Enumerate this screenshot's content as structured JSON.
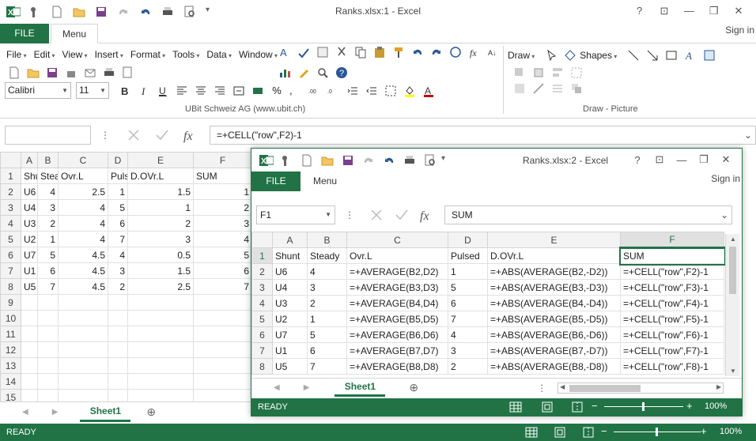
{
  "main": {
    "title": "Ranks.xlsx:1 - Excel",
    "tabs": {
      "file": "FILE",
      "menu": "Menu"
    },
    "signin": "Sign in",
    "menubar": [
      "File",
      "Edit",
      "View",
      "Insert",
      "Format",
      "Tools",
      "Data",
      "Window"
    ],
    "draw_items": [
      "Draw",
      "Shapes"
    ],
    "font_name": "Calibri",
    "font_size": "11",
    "group_labels": {
      "ubit": "UBit Schweiz AG   (www.ubit.ch)",
      "draw": "Draw - Picture"
    },
    "namebox": "",
    "formula": "=+CELL(\"row\",F2)-1",
    "columns": [
      "",
      "A",
      "B",
      "C",
      "D",
      "E",
      "F"
    ],
    "rows": [
      [
        "1",
        "Shunt",
        "Steady",
        "Ovr.L",
        "Pulsed",
        "D.OVr.L",
        "SUM"
      ],
      [
        "2",
        "U6",
        "4",
        "2.5",
        "1",
        "1.5",
        "1"
      ],
      [
        "3",
        "U4",
        "3",
        "4",
        "5",
        "1",
        "2"
      ],
      [
        "4",
        "U3",
        "2",
        "4",
        "6",
        "2",
        "3"
      ],
      [
        "5",
        "U2",
        "1",
        "4",
        "7",
        "3",
        "4"
      ],
      [
        "6",
        "U7",
        "5",
        "4.5",
        "4",
        "0.5",
        "5"
      ],
      [
        "7",
        "U1",
        "6",
        "4.5",
        "3",
        "1.5",
        "6"
      ],
      [
        "8",
        "U5",
        "7",
        "4.5",
        "2",
        "2.5",
        "7"
      ],
      [
        "9",
        "",
        "",
        "",
        "",
        "",
        ""
      ],
      [
        "10",
        "",
        "",
        "",
        "",
        "",
        ""
      ],
      [
        "11",
        "",
        "",
        "",
        "",
        "",
        ""
      ],
      [
        "12",
        "",
        "",
        "",
        "",
        "",
        ""
      ],
      [
        "13",
        "",
        "",
        "",
        "",
        "",
        ""
      ],
      [
        "14",
        "",
        "",
        "",
        "",
        "",
        ""
      ],
      [
        "15",
        "",
        "",
        "",
        "",
        "",
        ""
      ]
    ],
    "sheet_tab": "Sheet1",
    "status_left": "READY",
    "zoom": "100%"
  },
  "win2": {
    "title": "Ranks.xlsx:2 - Excel",
    "tabs": {
      "file": "FILE",
      "menu": "Menu"
    },
    "signin": "Sign in",
    "namebox": "F1",
    "formula": "SUM",
    "columns": [
      "",
      "A",
      "B",
      "C",
      "D",
      "E",
      "F"
    ],
    "rows": [
      [
        "1",
        "Shunt",
        "Steady",
        "Ovr.L",
        "Pulsed",
        "D.OVr.L",
        "SUM"
      ],
      [
        "2",
        "U6",
        "4",
        "=+AVERAGE(B2,D2)",
        "1",
        "=+ABS(AVERAGE(B2,-D2))",
        "=+CELL(\"row\",F2)-1"
      ],
      [
        "3",
        "U4",
        "3",
        "=+AVERAGE(B3,D3)",
        "5",
        "=+ABS(AVERAGE(B3,-D3))",
        "=+CELL(\"row\",F3)-1"
      ],
      [
        "4",
        "U3",
        "2",
        "=+AVERAGE(B4,D4)",
        "6",
        "=+ABS(AVERAGE(B4,-D4))",
        "=+CELL(\"row\",F4)-1"
      ],
      [
        "5",
        "U2",
        "1",
        "=+AVERAGE(B5,D5)",
        "7",
        "=+ABS(AVERAGE(B5,-D5))",
        "=+CELL(\"row\",F5)-1"
      ],
      [
        "6",
        "U7",
        "5",
        "=+AVERAGE(B6,D6)",
        "4",
        "=+ABS(AVERAGE(B6,-D6))",
        "=+CELL(\"row\",F6)-1"
      ],
      [
        "7",
        "U1",
        "6",
        "=+AVERAGE(B7,D7)",
        "3",
        "=+ABS(AVERAGE(B7,-D7))",
        "=+CELL(\"row\",F7)-1"
      ],
      [
        "8",
        "U5",
        "7",
        "=+AVERAGE(B8,D8)",
        "2",
        "=+ABS(AVERAGE(B8,-D8))",
        "=+CELL(\"row\",F8)-1"
      ]
    ],
    "sheet_tab": "Sheet1",
    "status_left": "READY",
    "zoom": "100%"
  },
  "colors": {
    "excel_green": "#217346",
    "header_gray": "#f3f3f3"
  }
}
